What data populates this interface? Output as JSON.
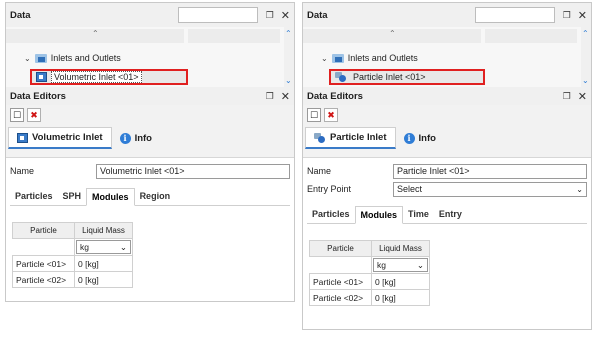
{
  "left": {
    "panel_title": "Data",
    "tree_node": "Inlets and Outlets",
    "tree_child": "Volumetric Inlet <01>",
    "editors_title": "Data Editors",
    "tab_main": "Volumetric Inlet",
    "tab_info": "Info",
    "fields": [
      {
        "label": "Name",
        "value": "Volumetric Inlet <01>"
      }
    ],
    "sub_tabs": [
      "Particles",
      "SPH",
      "Modules",
      "Region"
    ],
    "active_sub_tab": "Modules",
    "grid": {
      "col1": "Particle",
      "col2": "Liquid Mass",
      "unit": "kg",
      "rows": [
        {
          "name": "Particle <01>",
          "value": "0 [kg]"
        },
        {
          "name": "Particle <02>",
          "value": "0 [kg]"
        }
      ]
    }
  },
  "right": {
    "panel_title": "Data",
    "tree_node": "Inlets and Outlets",
    "tree_child": "Particle Inlet <01>",
    "editors_title": "Data Editors",
    "tab_main": "Particle Inlet",
    "tab_info": "Info",
    "fields": [
      {
        "label": "Name",
        "value": "Particle Inlet <01>"
      },
      {
        "label": "Entry Point",
        "value": "Select"
      }
    ],
    "sub_tabs": [
      "Particles",
      "Modules",
      "Time",
      "Entry"
    ],
    "active_sub_tab": "Modules",
    "grid": {
      "col1": "Particle",
      "col2": "Liquid Mass",
      "unit": "kg",
      "rows": [
        {
          "name": "Particle <01>",
          "value": "0 [kg]"
        },
        {
          "name": "Particle <02>",
          "value": "0 [kg]"
        }
      ]
    }
  },
  "colors": {
    "highlight": "#e02020",
    "accent": "#2f7dd6",
    "delete": "#d01414"
  },
  "icons": {
    "pin": "pin-icon",
    "close": "close-icon",
    "new": "new-document-icon",
    "delete": "delete-icon",
    "info": "info-icon",
    "folder": "folder-icon",
    "volumetric": "volumetric-inlet-icon",
    "particle": "particle-inlet-icon"
  }
}
